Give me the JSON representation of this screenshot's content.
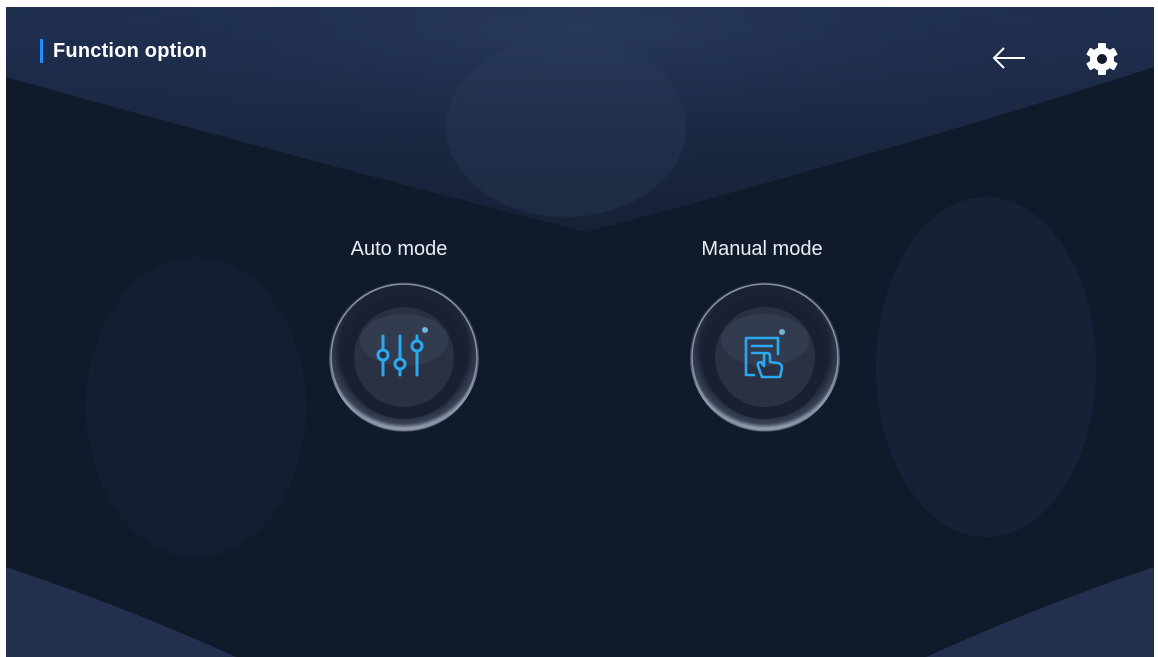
{
  "header": {
    "title": "Function option",
    "back_icon": "arrow-left-icon",
    "settings_icon": "gear-icon"
  },
  "modes": [
    {
      "label": "Auto mode",
      "icon": "sliders-icon"
    },
    {
      "label": "Manual mode",
      "icon": "touch-document-icon"
    }
  ],
  "colors": {
    "background": "#111827",
    "accent": "#1e90ff",
    "icon_blue": "#2aa8f0",
    "text": "#ffffff"
  }
}
